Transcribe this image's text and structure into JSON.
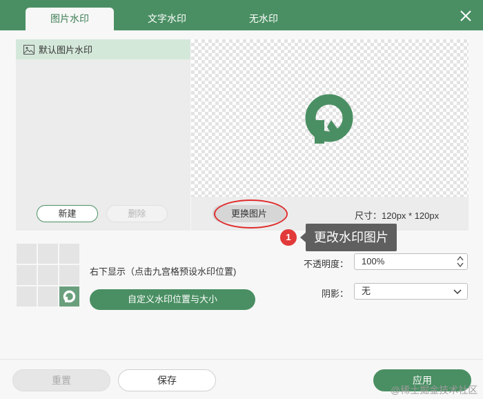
{
  "tabs": [
    {
      "label": "图片水印",
      "active": true
    },
    {
      "label": "文字水印",
      "active": false
    },
    {
      "label": "无水印",
      "active": false
    }
  ],
  "list": {
    "items": [
      {
        "label": "默认图片水印",
        "icon": "image-icon"
      }
    ]
  },
  "buttons": {
    "new": "新建",
    "delete": "删除",
    "replace": "更换图片"
  },
  "size_text": "尺寸：120px * 120px",
  "tooltip": {
    "badge": "1",
    "text": "更改水印图片"
  },
  "position": {
    "text": "右下显示（点击九宫格预设水印位置)",
    "custom_button": "自定义水印位置与大小",
    "selected_cell": 9
  },
  "opacity": {
    "label": "不透明度：",
    "value": "100%"
  },
  "shadow": {
    "label": "阴影：",
    "value": "无"
  },
  "footer": {
    "reset": "重置",
    "save": "保存",
    "apply": "应用"
  },
  "watermark_text": "@稀土掘金技术社区",
  "colors": {
    "accent": "#4a8f63",
    "highlight": "#e02c2c"
  }
}
